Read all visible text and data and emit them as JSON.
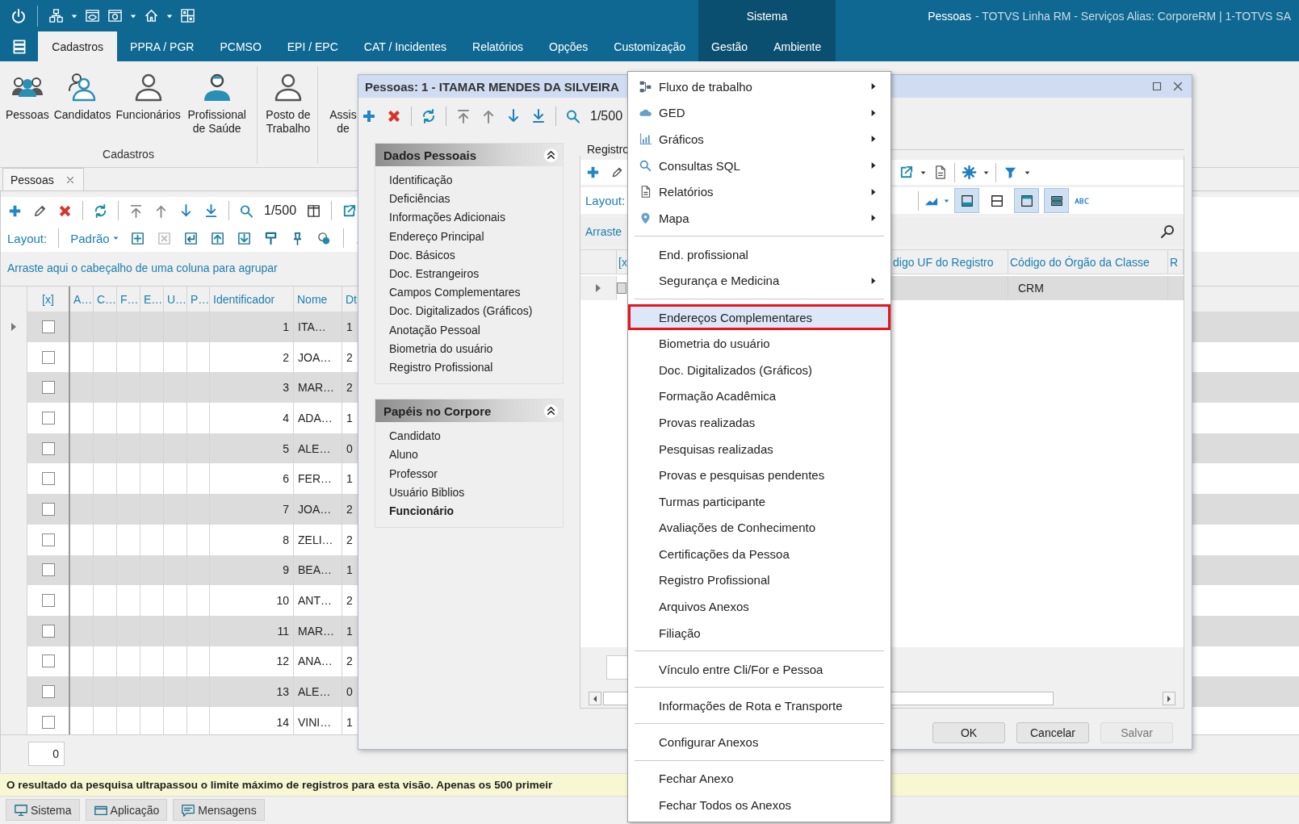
{
  "top_bar": {
    "context_label": "Sistema",
    "window_title": "Pessoas",
    "window_subtitle": "- TOTVS Linha RM - Serviços  Alias: CorporeRM | 1-TOTVS SA"
  },
  "ribbon_tabs": [
    {
      "label": "Cadastros",
      "selected": true,
      "kind": "main"
    },
    {
      "label": "PPRA / PGR",
      "selected": false,
      "kind": "main"
    },
    {
      "label": "PCMSO",
      "selected": false,
      "kind": "main"
    },
    {
      "label": "EPI / EPC",
      "selected": false,
      "kind": "main"
    },
    {
      "label": "CAT / Incidentes",
      "selected": false,
      "kind": "main"
    },
    {
      "label": "Relatórios",
      "selected": false,
      "kind": "main"
    },
    {
      "label": "Opções",
      "selected": false,
      "kind": "main"
    },
    {
      "label": "Customização",
      "selected": false,
      "kind": "main"
    },
    {
      "label": "Gestão",
      "selected": false,
      "kind": "context"
    },
    {
      "label": "Ambiente",
      "selected": false,
      "kind": "context"
    }
  ],
  "ribbon_groups": [
    {
      "label": "Cadastros",
      "buttons": [
        "Pessoas",
        "Candidatos",
        "Funcionários",
        "Profissional de Saúde"
      ]
    },
    {
      "buttons": [
        "Posto de Trabalho"
      ]
    },
    {
      "buttons": [
        "Assis de"
      ]
    }
  ],
  "document_tab": {
    "label": "Pessoas"
  },
  "toolbar": {
    "record_counter": "1/500",
    "layout_label": "Layout:",
    "layout_value": "Padrão"
  },
  "group_hint": "Arraste aqui o cabeçalho de uma coluna para agrupar",
  "grid": {
    "columns": [
      "[x]",
      "A…",
      "C…",
      "F…",
      "E…",
      "U…",
      "P…",
      "Identificador",
      "Nome",
      "Dt"
    ],
    "rows": [
      {
        "selected": true,
        "checked": false,
        "id": "1",
        "name": "ITA…",
        "dt": "1"
      },
      {
        "selected": false,
        "checked": false,
        "id": "2",
        "name": "JOA…",
        "dt": "2"
      },
      {
        "selected": false,
        "checked": false,
        "id": "3",
        "name": "MAR…",
        "dt": "2"
      },
      {
        "selected": false,
        "checked": false,
        "id": "4",
        "name": "ADA…",
        "dt": "1"
      },
      {
        "selected": false,
        "checked": false,
        "id": "5",
        "name": "ALE…",
        "dt": "0"
      },
      {
        "selected": false,
        "checked": false,
        "id": "6",
        "name": "FER…",
        "dt": "1"
      },
      {
        "selected": false,
        "checked": false,
        "id": "7",
        "name": "JOA…",
        "dt": "2"
      },
      {
        "selected": false,
        "checked": false,
        "id": "8",
        "name": "ZELI…",
        "dt": "2"
      },
      {
        "selected": false,
        "checked": false,
        "id": "9",
        "name": "BEA…",
        "dt": "1"
      },
      {
        "selected": false,
        "checked": false,
        "id": "10",
        "name": "ANT…",
        "dt": "2"
      },
      {
        "selected": false,
        "checked": false,
        "id": "11",
        "name": "MAR…",
        "dt": "1"
      },
      {
        "selected": false,
        "checked": false,
        "id": "12",
        "name": "ANA…",
        "dt": "2"
      },
      {
        "selected": false,
        "checked": false,
        "id": "13",
        "name": "ALE…",
        "dt": "0"
      },
      {
        "selected": false,
        "checked": false,
        "id": "14",
        "name": "VINI…",
        "dt": "1"
      }
    ]
  },
  "footer_count": "0",
  "status_message": "O resultado da pesquisa ultrapassou o limite máximo de registros para esta visão. Apenas os 500 primeir",
  "taskbar": [
    {
      "label": "Sistema"
    },
    {
      "label": "Aplicação"
    },
    {
      "label": "Mensagens"
    }
  ],
  "dialog": {
    "title": "Pessoas: 1 - ITAMAR MENDES DA SILVEIRA",
    "record_counter": "1/500",
    "nav_sections": [
      {
        "title": "Dados Pessoais",
        "expanded": true,
        "items": [
          {
            "label": "Identificação",
            "emphasized": false
          },
          {
            "label": "Deficiências",
            "emphasized": false
          },
          {
            "label": "Informações Adicionais",
            "emphasized": false
          },
          {
            "label": "Endereço Principal",
            "emphasized": false
          },
          {
            "label": "Doc. Básicos",
            "emphasized": false
          },
          {
            "label": "Doc. Estrangeiros",
            "emphasized": false
          },
          {
            "label": "Campos Complementares",
            "emphasized": false
          },
          {
            "label": "Doc. Digitalizados (Gráficos)",
            "emphasized": false
          },
          {
            "label": "Anotação Pessoal",
            "emphasized": false
          },
          {
            "label": "Biometria do usuário",
            "emphasized": false
          },
          {
            "label": "Registro Profissional",
            "emphasized": false
          }
        ]
      },
      {
        "title": "Papéis no Corpore",
        "expanded": true,
        "items": [
          {
            "label": "Candidato",
            "emphasized": false
          },
          {
            "label": "Aluno",
            "emphasized": false
          },
          {
            "label": "Professor",
            "emphasized": false
          },
          {
            "label": "Usuário Biblios",
            "emphasized": false
          },
          {
            "label": "Funcionário",
            "emphasized": true
          }
        ]
      }
    ],
    "registro": {
      "legend": "Registro",
      "layout_label": "Layout:",
      "hint": "Arraste",
      "left_column": "[x",
      "columns": [
        "digo UF do Registro",
        "Código do Órgão da Classe",
        "R"
      ],
      "rows": [
        {
          "selected": true,
          "checked": false,
          "orgao": "CRM"
        }
      ],
      "layout_toggles": [
        {
          "selected": true
        },
        {
          "selected": false
        },
        {
          "selected": true
        },
        {
          "selected": true
        }
      ]
    },
    "buttons": [
      {
        "label": "OK",
        "disabled": false
      },
      {
        "label": "Cancelar",
        "disabled": false
      },
      {
        "label": "Salvar",
        "disabled": true
      }
    ]
  },
  "context_menu": {
    "sections": [
      [
        {
          "label": "Fluxo de trabalho",
          "submenu": true,
          "selected": false
        },
        {
          "label": "GED",
          "submenu": true,
          "selected": false
        },
        {
          "label": "Gráficos",
          "submenu": true,
          "selected": false
        },
        {
          "label": "Consultas SQL",
          "submenu": true,
          "selected": false
        },
        {
          "label": "Relatórios",
          "submenu": true,
          "selected": false
        },
        {
          "label": "Mapa",
          "submenu": true,
          "selected": false
        }
      ],
      [
        {
          "label": "End. profissional",
          "submenu": false,
          "selected": false
        },
        {
          "label": "Segurança e Medicina",
          "submenu": true,
          "selected": false
        }
      ],
      [
        {
          "label": "Endereços Complementares",
          "submenu": false,
          "selected": true
        },
        {
          "label": "Biometria do usuário",
          "submenu": false,
          "selected": false
        },
        {
          "label": "Doc. Digitalizados (Gráficos)",
          "submenu": false,
          "selected": false
        },
        {
          "label": "Formação Acadêmica",
          "submenu": false,
          "selected": false
        },
        {
          "label": "Provas realizadas",
          "submenu": false,
          "selected": false
        },
        {
          "label": "Pesquisas realizadas",
          "submenu": false,
          "selected": false
        },
        {
          "label": "Provas e pesquisas pendentes",
          "submenu": false,
          "selected": false
        },
        {
          "label": "Turmas participante",
          "submenu": false,
          "selected": false
        },
        {
          "label": "Avaliações de Conhecimento",
          "submenu": false,
          "selected": false
        },
        {
          "label": "Certificações da Pessoa",
          "submenu": false,
          "selected": false
        },
        {
          "label": "Registro Profissional",
          "submenu": false,
          "selected": false
        },
        {
          "label": "Arquivos Anexos",
          "submenu": false,
          "selected": false
        },
        {
          "label": "Filiação",
          "submenu": false,
          "selected": false
        }
      ],
      [
        {
          "label": "Vínculo entre Cli/For e Pessoa",
          "submenu": false,
          "selected": false
        }
      ],
      [
        {
          "label": "Informações de Rota e Transporte",
          "submenu": false,
          "selected": false
        }
      ],
      [
        {
          "label": "Configurar Anexos",
          "submenu": false,
          "selected": false
        }
      ],
      [
        {
          "label": "Fechar Anexo",
          "submenu": false,
          "selected": false
        },
        {
          "label": "Fechar Todos os Anexos",
          "submenu": false,
          "selected": false
        }
      ]
    ]
  }
}
